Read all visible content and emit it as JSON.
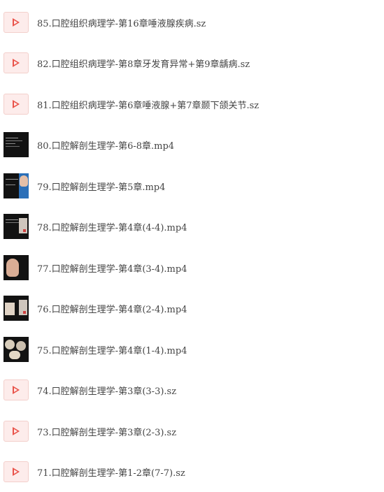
{
  "files": [
    {
      "name": "85.口腔组织病理学-第16章唾液腺疾病.sz",
      "type": "sz",
      "icon": "sz-play-icon"
    },
    {
      "name": "82.口腔组织病理学-第8章牙发育异常+第9章龋病.sz",
      "type": "sz",
      "icon": "sz-play-icon"
    },
    {
      "name": "81.口腔组织病理学-第6章唾液腺+第7章颞下颌关节.sz",
      "type": "sz",
      "icon": "sz-play-icon"
    },
    {
      "name": "80.口腔解剖生理学-第6-8章.mp4",
      "type": "mp4",
      "icon": "video-thumbnail"
    },
    {
      "name": "79.口腔解剖生理学-第5章.mp4",
      "type": "mp4",
      "icon": "video-thumbnail"
    },
    {
      "name": "78.口腔解剖生理学-第4章(4-4).mp4",
      "type": "mp4",
      "icon": "video-thumbnail"
    },
    {
      "name": "77.口腔解剖生理学-第4章(3-4).mp4",
      "type": "mp4",
      "icon": "video-thumbnail"
    },
    {
      "name": "76.口腔解剖生理学-第4章(2-4).mp4",
      "type": "mp4",
      "icon": "video-thumbnail"
    },
    {
      "name": "75.口腔解剖生理学-第4章(1-4).mp4",
      "type": "mp4",
      "icon": "video-thumbnail"
    },
    {
      "name": "74.口腔解剖生理学-第3章(3-3).sz",
      "type": "sz",
      "icon": "sz-play-icon"
    },
    {
      "name": "73.口腔解剖生理学-第3章(2-3).sz",
      "type": "sz",
      "icon": "sz-play-icon"
    },
    {
      "name": "71.口腔解剖生理学-第1-2章(7-7).sz",
      "type": "sz",
      "icon": "sz-play-icon"
    }
  ],
  "colors": {
    "text": "#444444",
    "sz_icon_bg": "#fdeceb",
    "sz_icon_play": "#e9534a"
  }
}
